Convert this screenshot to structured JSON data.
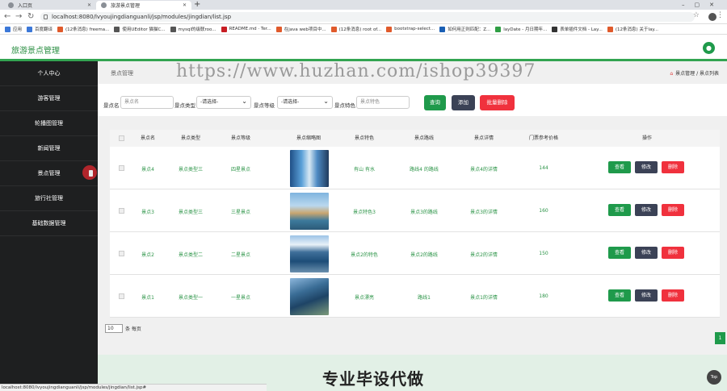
{
  "browser": {
    "tabs": [
      {
        "title": "入口页",
        "active": false
      },
      {
        "title": "旅游景点管理",
        "active": true
      }
    ],
    "new_tab": "+",
    "url": "localhost:8080/lvyoujingdianguanli/jsp/modules/jingdian/list.jsp",
    "bookmarks": [
      {
        "label": "应用",
        "color": "#3c78d8"
      },
      {
        "label": "百度翻译",
        "color": "#3c78d8"
      },
      {
        "label": "(12条消息) freema...",
        "color": "#e05a2b"
      },
      {
        "label": "使用UEditor 猫猫C...",
        "color": "#555555"
      },
      {
        "label": "mysql的级联roo...",
        "color": "#555555"
      },
      {
        "label": "README.md · Ter...",
        "color": "#c71d23"
      },
      {
        "label": "在java web项目中...",
        "color": "#e05a2b"
      },
      {
        "label": "(12条消息) root of...",
        "color": "#e05a2b"
      },
      {
        "label": "bootstrap-select...",
        "color": "#e05a2b"
      },
      {
        "label": "如何用正则匹配：Z...",
        "color": "#1a5fb4"
      },
      {
        "label": "layDate - 月日期年...",
        "color": "#2f9e44"
      },
      {
        "label": "表单插件文档 - Lay...",
        "color": "#333333"
      },
      {
        "label": "(12条消息) 关于lay...",
        "color": "#e05a2b"
      }
    ]
  },
  "header": {
    "logo": "旅游景点管理",
    "avatar_icon": "user-icon"
  },
  "sidebar": {
    "items": [
      {
        "label": "个人中心"
      },
      {
        "label": "游客管理"
      },
      {
        "label": "轮播图管理"
      },
      {
        "label": "新闻管理"
      },
      {
        "label": "景点管理"
      },
      {
        "label": "旅行社管理"
      },
      {
        "label": "基础数据管理"
      }
    ]
  },
  "breadcrumb": {
    "title": "景点管理",
    "path": "景点管理 / 景点列表"
  },
  "watermark": "https://www.huzhan.com/ishop39397",
  "filters": {
    "name_label": "景点名",
    "name_placeholder": "景点名",
    "type_label": "景点类型",
    "type_value": "-请选择-",
    "level_label": "景点等级",
    "level_value": "-请选择-",
    "feature_label": "景点特色",
    "feature_placeholder": "景点特色",
    "query_btn": "查询",
    "add_btn": "添加",
    "batch_delete_btn": "批量删除"
  },
  "table": {
    "headers": [
      "景点名",
      "景点类型",
      "景点等级",
      "景点缩略图",
      "景点特色",
      "景点路线",
      "景点详情",
      "门票参考价格",
      "操作"
    ],
    "rows": [
      {
        "name": "景点4",
        "type": "景点类型三",
        "level": "四星景点",
        "feature": "有山 有水",
        "route": "路线4 的路线",
        "detail": "景点4的详情",
        "price": "144"
      },
      {
        "name": "景点3",
        "type": "景点类型三",
        "level": "三星景点",
        "feature": "景点特色3",
        "route": "景点3的路线",
        "detail": "景点3的详情",
        "price": "160"
      },
      {
        "name": "景点2",
        "type": "景点类型二",
        "level": "二星景点",
        "feature": "景点2的特色",
        "route": "景点2的路线",
        "detail": "景点2的详情",
        "price": "150"
      },
      {
        "name": "景点1",
        "type": "景点类型一",
        "level": "一星景点",
        "feature": "景点漂亮",
        "route": "路线1",
        "detail": "景点1的详情",
        "price": "180"
      }
    ],
    "view_btn": "查看",
    "edit_btn": "修改",
    "delete_btn": "删除"
  },
  "pager": {
    "page_size": "10",
    "suffix": "条 每页",
    "current_page": "1"
  },
  "promo": "专业毕设代做",
  "status_url": "localhost:8080/lvyoujingdianguanli/jsp/modules/jingdian/list.jsp#",
  "top_button": "Top",
  "colors": {
    "primary": "#1f9a4b",
    "dark": "#1e1f20",
    "danger": "#f0313d",
    "slate": "#3b4256"
  }
}
